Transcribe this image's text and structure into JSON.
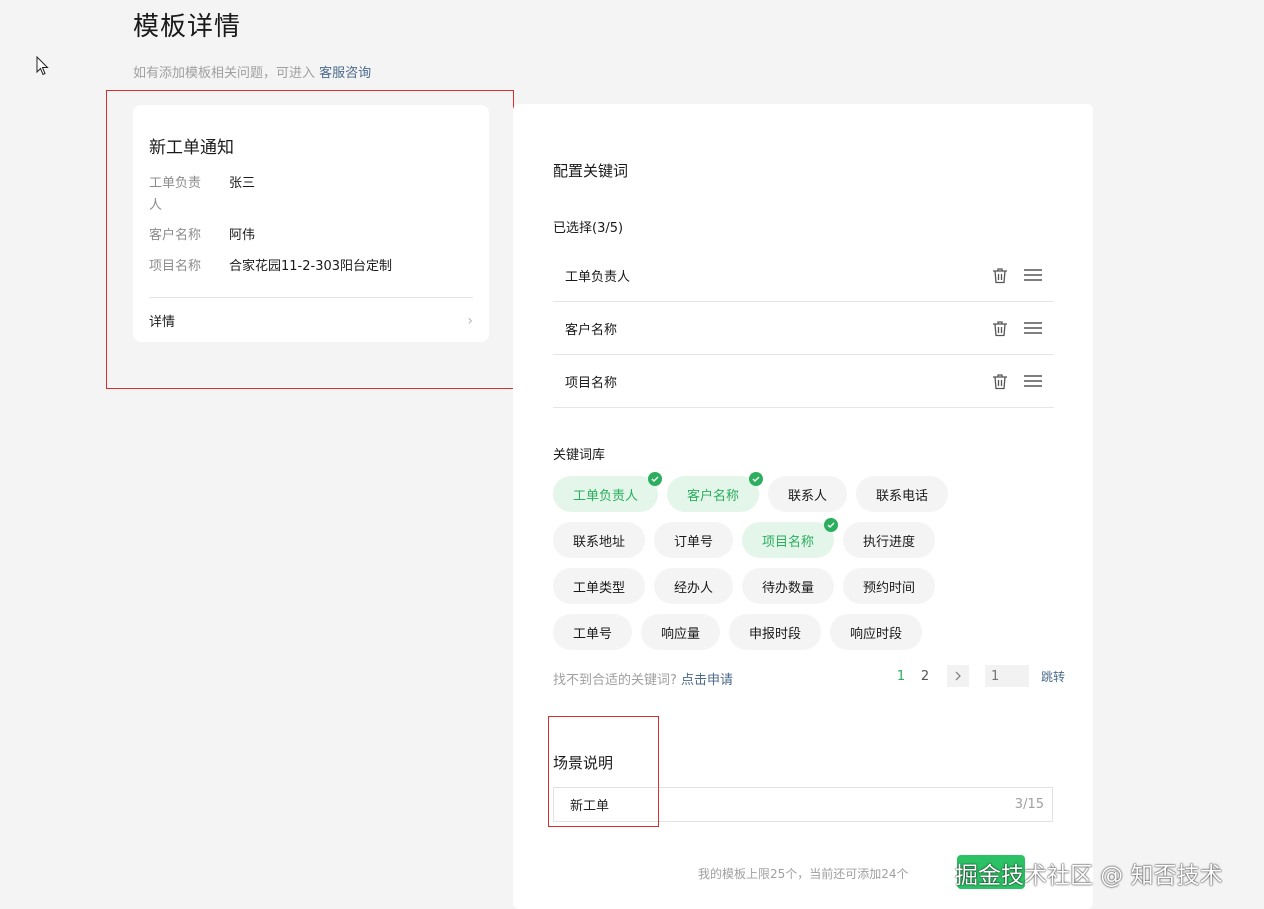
{
  "page": {
    "title": "模板详情",
    "subtitle_prefix": "如有添加模板相关问题，可进入",
    "subtitle_link": "客服咨询"
  },
  "preview": {
    "title": "新工单通知",
    "fields": [
      {
        "label": "工单负责人",
        "value": "张三"
      },
      {
        "label": "客户名称",
        "value": "阿伟"
      },
      {
        "label": "项目名称",
        "value": "合家花园11-2-303阳台定制"
      }
    ],
    "detail_label": "详情"
  },
  "config": {
    "title": "配置关键词",
    "selected_label": "已选择(3/5)",
    "selected": [
      "工单负责人",
      "客户名称",
      "项目名称"
    ],
    "library_label": "关键词库",
    "library": [
      [
        {
          "label": "工单负责人",
          "selected": true
        },
        {
          "label": "客户名称",
          "selected": true
        },
        {
          "label": "联系人",
          "selected": false
        },
        {
          "label": "联系电话",
          "selected": false
        }
      ],
      [
        {
          "label": "联系地址",
          "selected": false
        },
        {
          "label": "订单号",
          "selected": false
        },
        {
          "label": "项目名称",
          "selected": true
        },
        {
          "label": "执行进度",
          "selected": false
        }
      ],
      [
        {
          "label": "工单类型",
          "selected": false
        },
        {
          "label": "经办人",
          "selected": false
        },
        {
          "label": "待办数量",
          "selected": false
        },
        {
          "label": "预约时间",
          "selected": false
        }
      ],
      [
        {
          "label": "工单号",
          "selected": false
        },
        {
          "label": "响应量",
          "selected": false
        },
        {
          "label": "申报时段",
          "selected": false
        },
        {
          "label": "响应时段",
          "selected": false
        }
      ]
    ],
    "not_found_text": "找不到合适的关键词?",
    "apply_link": "点击申请",
    "pagination": {
      "pages": [
        "1",
        "2"
      ],
      "current": "1",
      "jump_placeholder": "1",
      "jump_label": "跳转"
    },
    "scene_title": "场景说明",
    "scene_value": "新工单",
    "scene_count": "3/15"
  },
  "footer": {
    "limit_text": "我的模板上限25个，当前还可添加24个",
    "watermark": "掘金技术社区 @ 知否技术"
  },
  "colors": {
    "accent": "#2bae5e",
    "annotation": "#d62f2f"
  }
}
